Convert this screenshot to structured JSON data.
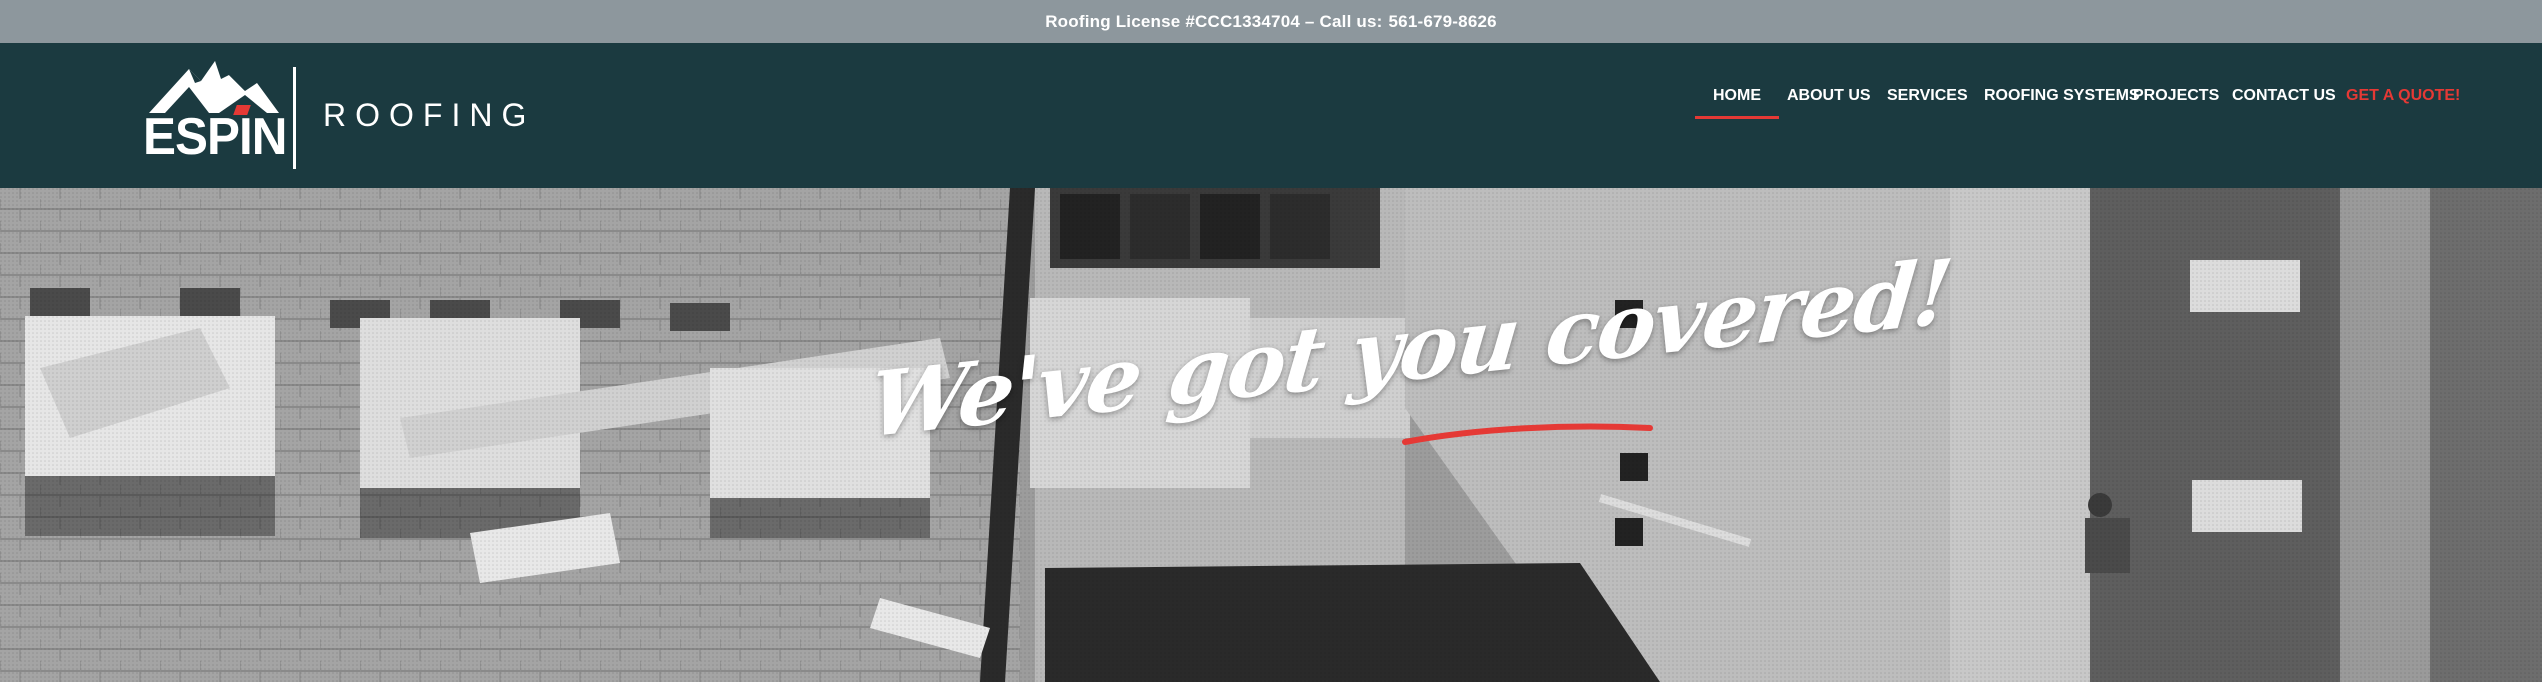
{
  "topbar": {
    "license": "Roofing License #CCC1334704 – Call us:",
    "phone": "561-679-8626"
  },
  "brand": {
    "name": "ESPIN",
    "tagline": "ROOFING",
    "accent_color": "#e53935",
    "header_color": "#1b3a40",
    "topbar_color": "#8d979d"
  },
  "nav": {
    "items": [
      {
        "label": "HOME",
        "active": true
      },
      {
        "label": "ABOUT US",
        "active": false
      },
      {
        "label": "SERVICES",
        "active": false
      },
      {
        "label": "ROOFING SYSTEMS",
        "active": false
      },
      {
        "label": "PROJECTS",
        "active": false
      },
      {
        "label": "CONTACT US",
        "active": false
      },
      {
        "label": "GET A QUOTE!",
        "active": false
      }
    ]
  },
  "hero": {
    "headline": "We've got you covered!"
  }
}
